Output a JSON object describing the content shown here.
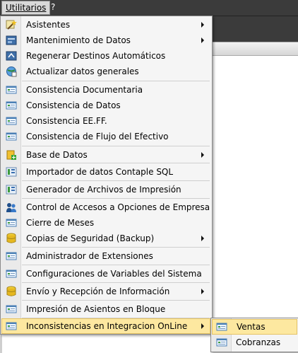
{
  "menubar": {
    "items": [
      {
        "label": "Utilitarios",
        "active": true
      },
      {
        "label": "?",
        "active": false
      }
    ]
  },
  "menu": {
    "items": [
      {
        "label": "Asistentes",
        "icon": "wizard-wand-icon",
        "submenu": true
      },
      {
        "label": "Mantenimiento de Datos",
        "icon": "data-folder-icon",
        "submenu": true
      },
      {
        "label": "Regenerar Destinos Automáticos",
        "icon": "regenerate-icon",
        "submenu": false
      },
      {
        "label": "Actualizar datos generales",
        "icon": "globe-update-icon",
        "submenu": false
      },
      {
        "label": "Consistencia Documentaria",
        "icon": "form-window-icon",
        "submenu": false
      },
      {
        "label": "Consistencia de Datos",
        "icon": "form-window-icon",
        "submenu": false
      },
      {
        "label": "Consistencia EE.FF.",
        "icon": "form-window-icon",
        "submenu": false
      },
      {
        "label": "Consistencia de Flujo del Efectivo",
        "icon": "form-window-icon",
        "submenu": false
      },
      {
        "label": "Base de Datos",
        "icon": "database-add-icon",
        "submenu": true
      },
      {
        "label": "Importador de datos Contaple SQL",
        "icon": "import-table-icon",
        "submenu": false
      },
      {
        "label": "Generador de Archivos de Impresión",
        "icon": "import-table-icon",
        "submenu": false
      },
      {
        "label": "Control de Accesos a Opciones de Empresa",
        "icon": "users-icon",
        "submenu": false
      },
      {
        "label": "Cierre de Meses",
        "icon": "form-window-icon",
        "submenu": false
      },
      {
        "label": "Copias de Seguridad (Backup)",
        "icon": "database-icon",
        "submenu": true
      },
      {
        "label": "Administrador de Extensiones",
        "icon": "form-window-icon",
        "submenu": false
      },
      {
        "label": "Configuraciones de Variables del Sistema",
        "icon": "form-window-icon",
        "submenu": false
      },
      {
        "label": "Envío y Recepción de Información",
        "icon": "database-icon",
        "submenu": true
      },
      {
        "label": "Impresión de Asientos en Bloque",
        "icon": "form-window-icon",
        "submenu": false
      },
      {
        "label": "Inconsistencias en Integracion OnLine",
        "icon": "form-window-icon",
        "submenu": true,
        "highlighted": true
      }
    ]
  },
  "submenu": {
    "items": [
      {
        "label": "Ventas",
        "icon": "form-window-icon",
        "highlighted": true
      },
      {
        "label": "Cobranzas",
        "icon": "form-window-icon",
        "highlighted": false
      }
    ]
  },
  "colors": {
    "menubar_bg": "#3b3b3b",
    "menu_bg": "#f5f5f5",
    "highlight_bg": "#fde8a0",
    "highlight_border": "#e5c365"
  }
}
